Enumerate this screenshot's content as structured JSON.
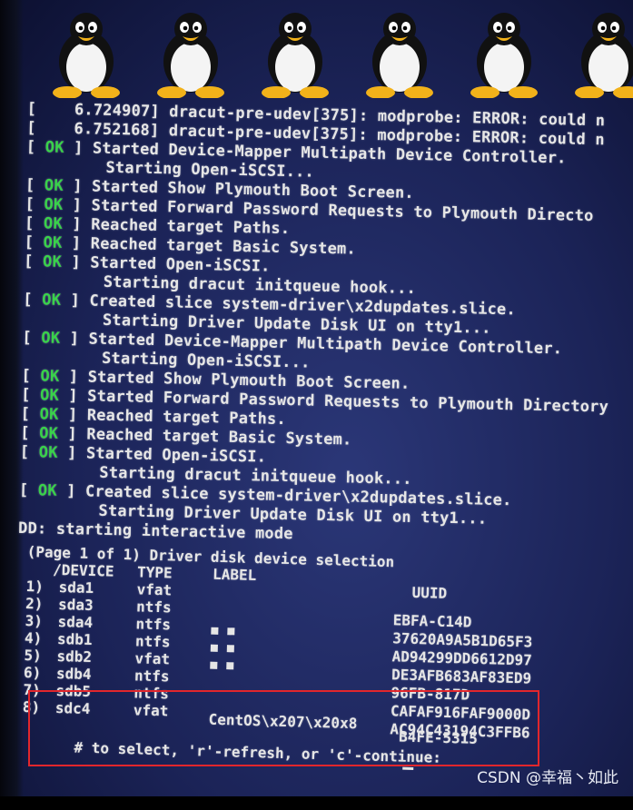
{
  "boot_log": [
    {
      "kind": "kernel",
      "text": "[    6.724907] dracut-pre-udev[375]: modprobe: ERROR: could n"
    },
    {
      "kind": "kernel",
      "text": "[    6.752168] dracut-pre-udev[375]: modprobe: ERROR: could n"
    },
    {
      "kind": "ok",
      "text": "Started Device-Mapper Multipath Device Controller."
    },
    {
      "kind": "plain",
      "text": "Starting Open-iSCSI..."
    },
    {
      "kind": "ok",
      "text": "Started Show Plymouth Boot Screen."
    },
    {
      "kind": "ok",
      "text": "Started Forward Password Requests to Plymouth Directo"
    },
    {
      "kind": "ok",
      "text": "Reached target Paths."
    },
    {
      "kind": "ok",
      "text": "Reached target Basic System."
    },
    {
      "kind": "ok",
      "text": "Started Open-iSCSI."
    },
    {
      "kind": "plain",
      "text": "Starting dracut initqueue hook..."
    },
    {
      "kind": "ok",
      "text": "Created slice system-driver\\x2dupdates.slice."
    },
    {
      "kind": "plain",
      "text": "Starting Driver Update Disk UI on tty1..."
    },
    {
      "kind": "ok",
      "text": "Started Device-Mapper Multipath Device Controller."
    },
    {
      "kind": "plain",
      "text": "Starting Open-iSCSI..."
    },
    {
      "kind": "ok",
      "text": "Started Show Plymouth Boot Screen."
    },
    {
      "kind": "ok",
      "text": "Started Forward Password Requests to Plymouth Directory"
    },
    {
      "kind": "ok",
      "text": "Reached target Paths."
    },
    {
      "kind": "ok",
      "text": "Reached target Basic System."
    },
    {
      "kind": "ok",
      "text": "Started Open-iSCSI."
    },
    {
      "kind": "plain",
      "text": "Starting dracut initqueue hook..."
    },
    {
      "kind": "ok",
      "text": "Created slice system-driver\\x2dupdates.slice."
    },
    {
      "kind": "plain",
      "text": "Starting Driver Update Disk UI on tty1..."
    },
    {
      "kind": "raw",
      "text": "DD: starting interactive mode"
    }
  ],
  "ok_label": "OK",
  "selection": {
    "title": "(Page 1 of 1) Driver disk device selection",
    "headers": {
      "device": "   /DEVICE",
      "type": "TYPE",
      "label": "LABEL",
      "uuid": "UUID"
    },
    "rows": [
      {
        "num": "1)",
        "device": "sda1",
        "type": "vfat",
        "label": "",
        "uuid": ""
      },
      {
        "num": "2)",
        "device": "sda3",
        "type": "ntfs",
        "label": "",
        "uuid": "EBFA-C14D"
      },
      {
        "num": "3)",
        "device": "sda4",
        "type": "ntfs",
        "label": "",
        "uuid": "37620A9A5B1D65F3"
      },
      {
        "num": "4)",
        "device": "sdb1",
        "type": "ntfs",
        "label": "",
        "uuid": "AD94299DD6612D97"
      },
      {
        "num": "5)",
        "device": "sdb2",
        "type": "vfat",
        "label": "",
        "uuid": "DE3AFB683AF83ED9"
      },
      {
        "num": "6)",
        "device": "sdb4",
        "type": "ntfs",
        "label": "",
        "uuid": "96FB-817D"
      },
      {
        "num": "7)",
        "device": "sdb5",
        "type": "ntfs",
        "label": "",
        "uuid": "CAFAF916FAF9000D"
      },
      {
        "num": "8)",
        "device": "sdc4",
        "type": "vfat",
        "label": "CentOS\\x207\\x20x8",
        "uuid": "AC94C43194C3FFB6"
      }
    ],
    "extra_uuid": "B4FE-5315",
    "prompt": "# to select, 'r'-refresh, or 'c'-continue:"
  },
  "watermark": "CSDN @幸福丶如此",
  "colors": {
    "ok": "#39d24a",
    "screen": "#1b2357",
    "highlight": "#e2262c"
  }
}
